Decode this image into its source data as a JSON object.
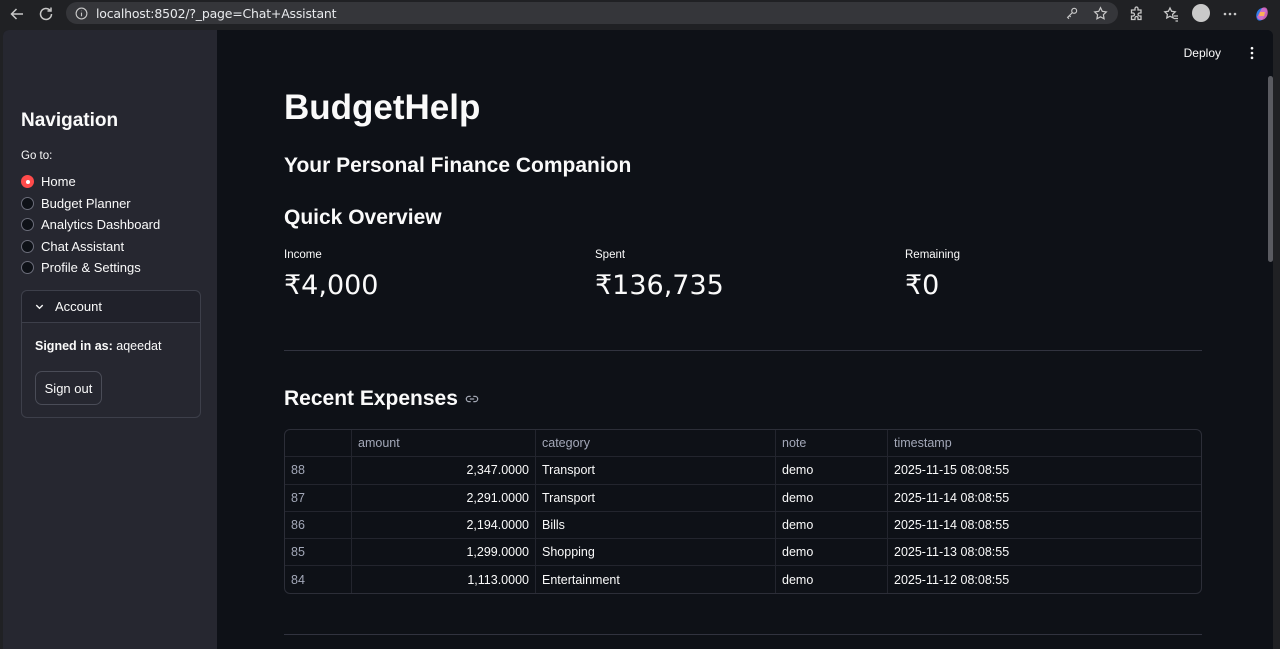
{
  "browser": {
    "url": "localhost:8502/?_page=Chat+Assistant"
  },
  "header": {
    "deploy_label": "Deploy"
  },
  "sidebar": {
    "title": "Navigation",
    "goto_label": "Go to:",
    "items": [
      {
        "label": "Home",
        "selected": true
      },
      {
        "label": "Budget Planner",
        "selected": false
      },
      {
        "label": "Analytics Dashboard",
        "selected": false
      },
      {
        "label": "Chat Assistant",
        "selected": false
      },
      {
        "label": "Profile & Settings",
        "selected": false
      }
    ],
    "account": {
      "title": "Account",
      "signed_in_prefix": "Signed in as:",
      "username": "aqeedat",
      "sign_out_label": "Sign out"
    }
  },
  "main": {
    "title": "BudgetHelp",
    "subtitle": "Your Personal Finance Companion",
    "overview_title": "Quick Overview",
    "metrics": [
      {
        "label": "Income",
        "value": "₹4,000"
      },
      {
        "label": "Spent",
        "value": "₹136,735"
      },
      {
        "label": "Remaining",
        "value": "₹0"
      }
    ],
    "recent_title": "Recent Expenses",
    "table": {
      "columns": [
        "",
        "amount",
        "category",
        "note",
        "timestamp"
      ],
      "rows": [
        [
          "88",
          "2,347.0000",
          "Transport",
          "demo",
          "2025-11-15 08:08:55"
        ],
        [
          "87",
          "2,291.0000",
          "Transport",
          "demo",
          "2025-11-14 08:08:55"
        ],
        [
          "86",
          "2,194.0000",
          "Bills",
          "demo",
          "2025-11-14 08:08:55"
        ],
        [
          "85",
          "1,299.0000",
          "Shopping",
          "demo",
          "2025-11-13 08:08:55"
        ],
        [
          "84",
          "1,113.0000",
          "Entertainment",
          "demo",
          "2025-11-12 08:08:55"
        ]
      ]
    }
  },
  "colors": {
    "accent": "#ff4b4b",
    "sidebar_bg": "#262730",
    "main_bg": "#0e1117"
  }
}
